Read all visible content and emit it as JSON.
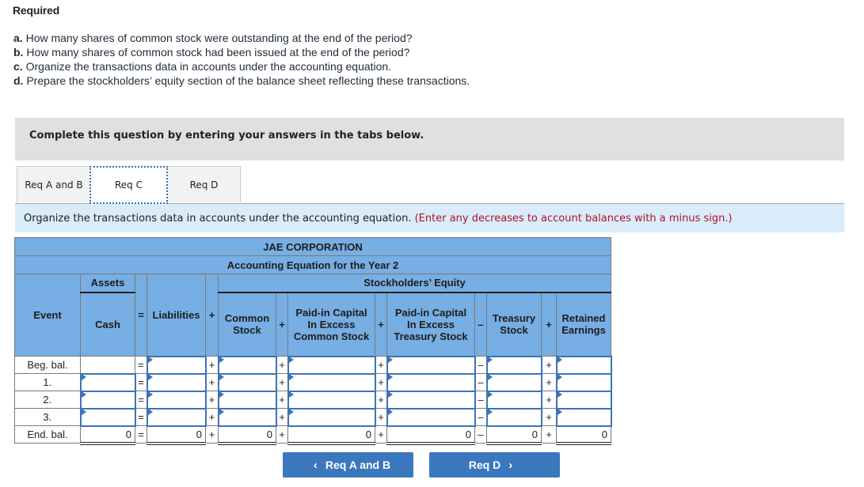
{
  "required": {
    "title": "Required",
    "items": [
      {
        "letter": "a.",
        "text": "How many shares of common stock were outstanding at the end of the period?"
      },
      {
        "letter": "b.",
        "text": "How many shares of common stock had been issued at the end of the period?"
      },
      {
        "letter": "c.",
        "text": "Organize the transactions data in accounts under the accounting equation."
      },
      {
        "letter": "d.",
        "text": "Prepare the stockholders’ equity section of the balance sheet reflecting these transactions."
      }
    ]
  },
  "instructions": "Complete this question by entering your answers in the tabs below.",
  "tabs": [
    {
      "label": "Req A and B",
      "active": false
    },
    {
      "label": "Req C",
      "active": true
    },
    {
      "label": "Req D",
      "active": false
    }
  ],
  "prompt": {
    "text": "Organize the transactions data in accounts under the accounting equation.",
    "hint": "(Enter any decreases to account balances with a minus sign.)"
  },
  "table": {
    "company": "JAE CORPORATION",
    "subtitle": "Accounting Equation for the Year 2",
    "group_assets": "Assets",
    "group_equity": "Stockholders’ Equity",
    "headers": {
      "event": "Event",
      "cash": "Cash",
      "eq": "=",
      "liabilities": "Liabilities",
      "plus": "+",
      "minus": "–",
      "common_stock_1": "Common",
      "common_stock_2": "Stock",
      "pic_cs_1": "Paid-in Capital",
      "pic_cs_2": "In Excess",
      "pic_cs_3": "Common Stock",
      "pic_ts_1": "Paid-in Capital",
      "pic_ts_2": "In Excess",
      "pic_ts_3": "Treasury Stock",
      "treasury_1": "Treasury",
      "treasury_2": "Stock",
      "retained_1": "Retained",
      "retained_2": "Earnings"
    },
    "rows": [
      {
        "event": "Beg. bal.",
        "cash": "",
        "liabilities": "",
        "common_stock": "",
        "pic_cs": "",
        "pic_ts": "",
        "treasury": "",
        "retained": ""
      },
      {
        "event": "1.",
        "cash": "",
        "liabilities": "",
        "common_stock": "",
        "pic_cs": "",
        "pic_ts": "",
        "treasury": "",
        "retained": ""
      },
      {
        "event": "2.",
        "cash": "",
        "liabilities": "",
        "common_stock": "",
        "pic_cs": "",
        "pic_ts": "",
        "treasury": "",
        "retained": ""
      },
      {
        "event": "3.",
        "cash": "",
        "liabilities": "",
        "common_stock": "",
        "pic_cs": "",
        "pic_ts": "",
        "treasury": "",
        "retained": ""
      }
    ],
    "end": {
      "event": "End. bal.",
      "cash": "0",
      "liabilities": "0",
      "common_stock": "0",
      "pic_cs": "0",
      "pic_ts": "0",
      "treasury": "0",
      "retained": "0"
    },
    "operators": {
      "eq": "=",
      "plus": "+",
      "minus": "–"
    }
  },
  "nav": {
    "prev_label": "Req A and B",
    "prev_icon": "‹",
    "next_label": "Req D",
    "next_icon": "›"
  }
}
